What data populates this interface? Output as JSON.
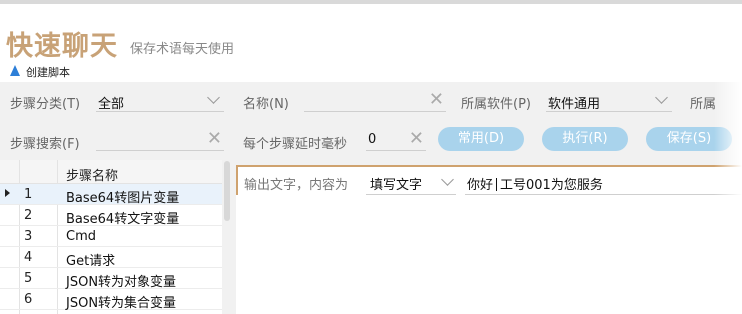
{
  "hero": {
    "title": "快速聊天",
    "subtitle": "保存术语每天使用"
  },
  "window": {
    "title": "创建脚本",
    "accent": "#2d7fd8"
  },
  "filters": {
    "category_label": "步骤分类(T)",
    "category_value": "全部",
    "name_label": "名称(N)",
    "name_value": "",
    "software_label": "所属软件(P)",
    "software_value": "软件通用",
    "software_label_cut": "所属",
    "search_label": "步骤搜索(F)",
    "search_value": "",
    "delay_label": "每个步骤延时毫秒",
    "delay_value": "0"
  },
  "buttons": {
    "common": "常用(D)",
    "run": "执行(R)",
    "save": "保存(S)",
    "color": "#a9d3ec"
  },
  "table": {
    "header": "步骤名称",
    "rows": [
      {
        "num": "1",
        "name": "Base64转图片变量",
        "selected": true
      },
      {
        "num": "2",
        "name": "Base64转文字变量"
      },
      {
        "num": "3",
        "name": "Cmd"
      },
      {
        "num": "4",
        "name": "Get请求"
      },
      {
        "num": "5",
        "name": "JSON转为对象变量"
      },
      {
        "num": "6",
        "name": "JSON转为集合变量"
      }
    ]
  },
  "output": {
    "label": "输出文字，内容为",
    "mode": "填写文字",
    "text_before": "你好",
    "text_after": "工号001为您服务",
    "accent": "#cfa26e"
  }
}
